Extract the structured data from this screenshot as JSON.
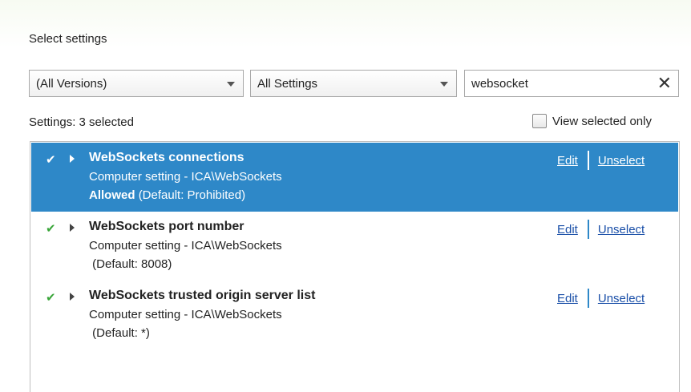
{
  "header": {
    "title": "Select settings"
  },
  "filters": {
    "version_dropdown": "(All Versions)",
    "settings_dropdown": "All Settings",
    "search_value": "websocket",
    "clear_symbol": "✕"
  },
  "summary": {
    "label": "Settings:",
    "count_text": "3 selected",
    "view_selected_label": "View selected only",
    "view_selected_checked": false
  },
  "rows": [
    {
      "name": "WebSockets connections",
      "path": "Computer setting - ICA\\WebSockets",
      "value": "Allowed",
      "default": "(Default: Prohibited)",
      "edit": "Edit",
      "unselect": "Unselect",
      "selected": true
    },
    {
      "name": "WebSockets port number",
      "path": "Computer setting - ICA\\WebSockets",
      "value": "",
      "default": "(Default: 8008)",
      "edit": "Edit",
      "unselect": "Unselect",
      "selected": false
    },
    {
      "name": "WebSockets trusted origin server list",
      "path": "Computer setting - ICA\\WebSockets",
      "value": "",
      "default": "(Default: *)",
      "edit": "Edit",
      "unselect": "Unselect",
      "selected": false
    }
  ],
  "icons": {
    "check": "check-icon",
    "expand": "expand-arrow-icon",
    "dropdown": "chevron-down-icon",
    "clear": "close-icon"
  },
  "colors": {
    "selection": "#2e88c8",
    "check_green": "#3aa63a",
    "link": "#1a4fa8"
  }
}
